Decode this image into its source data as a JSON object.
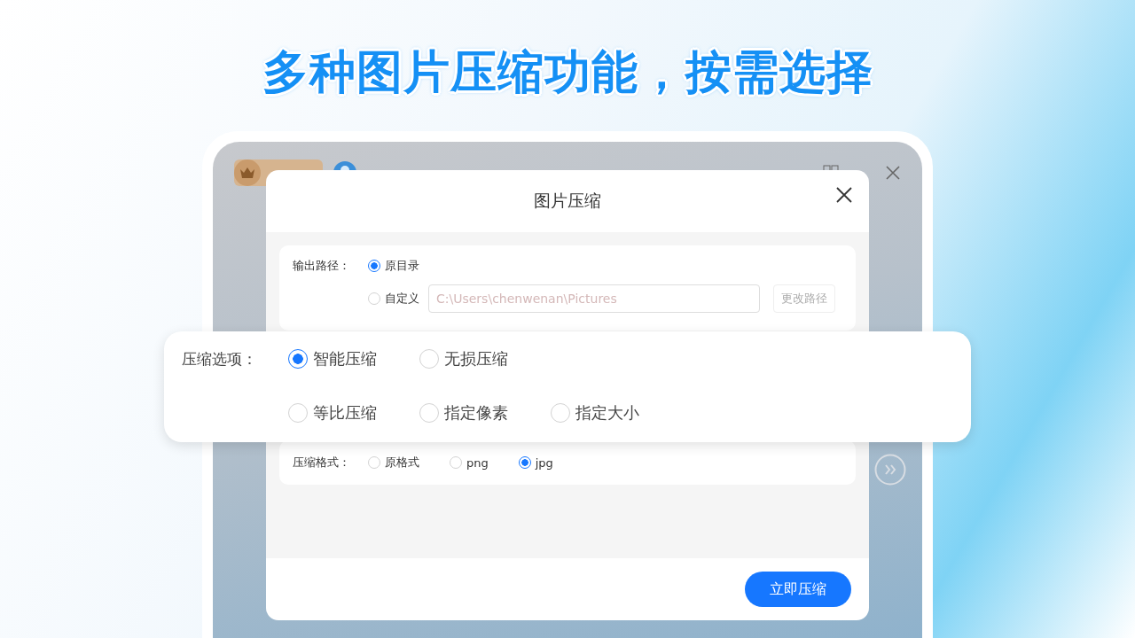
{
  "headline": "多种图片压缩功能，按需选择",
  "dialog": {
    "title": "图片压缩",
    "output_path": {
      "label": "输出路径：",
      "options": [
        {
          "label": "原目录",
          "selected": true
        },
        {
          "label": "自定义",
          "selected": false
        }
      ],
      "field": {
        "value": "C:\\Users\\chenwenan\\Pictures",
        "disabled": true
      },
      "button": {
        "label": "更改路径",
        "disabled": true
      }
    },
    "compression_options": {
      "label": "压缩选项：",
      "rows": [
        {
          "options": [
            {
              "label": "智能压缩",
              "selected": true
            },
            {
              "label": "无损压缩",
              "selected": false
            }
          ]
        },
        {
          "options": [
            {
              "label": "等比压缩",
              "selected": false
            },
            {
              "label": "指定像素",
              "selected": false
            },
            {
              "label": "指定大小",
              "selected": false
            }
          ]
        }
      ]
    },
    "format": {
      "label": "压缩格式：",
      "options": [
        {
          "label": "原格式",
          "selected": false
        },
        {
          "label": "png",
          "selected": false
        },
        {
          "label": "jpg",
          "selected": true
        }
      ]
    },
    "submit_button": "立即压缩"
  }
}
